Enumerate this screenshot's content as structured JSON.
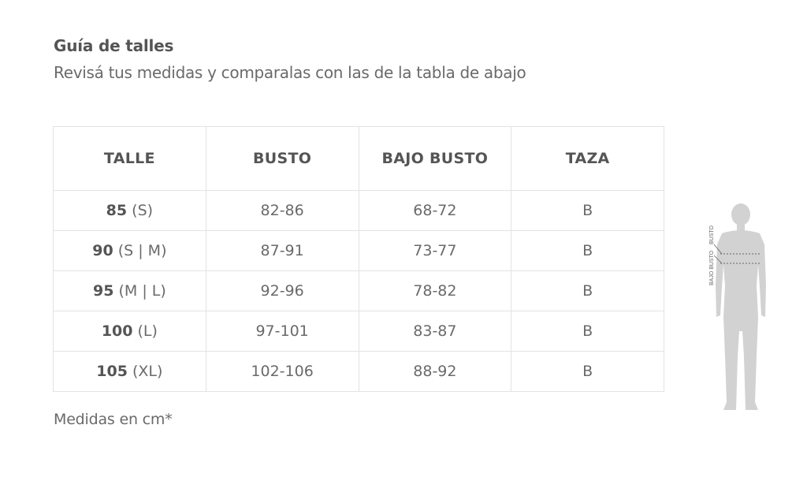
{
  "guide": {
    "title": "Guía de talles",
    "subtitle": "Revisá tus medidas y comparalas con las de la tabla de abajo",
    "footnote": "Medidas en cm*"
  },
  "table": {
    "headers": [
      "TALLE",
      "BUSTO",
      "BAJO BUSTO",
      "TAZA"
    ],
    "rows": [
      {
        "size_num": "85",
        "size_label": " (S)",
        "busto": "82-86",
        "bajo_busto": "68-72",
        "taza": "B"
      },
      {
        "size_num": "90",
        "size_label": " (S | M)",
        "busto": "87-91",
        "bajo_busto": "73-77",
        "taza": "B"
      },
      {
        "size_num": "95",
        "size_label": " (M | L)",
        "busto": "92-96",
        "bajo_busto": "78-82",
        "taza": "B"
      },
      {
        "size_num": "100",
        "size_label": " (L)",
        "busto": "97-101",
        "bajo_busto": "83-87",
        "taza": "B"
      },
      {
        "size_num": "105",
        "size_label": " (XL)",
        "busto": "102-106",
        "bajo_busto": "88-92",
        "taza": "B"
      }
    ]
  },
  "figure": {
    "busto_label": "BUSTO",
    "bajo_busto_label": "BAJO BUSTO",
    "fill_color": "#d2d2d2",
    "line_color": "#666666"
  }
}
